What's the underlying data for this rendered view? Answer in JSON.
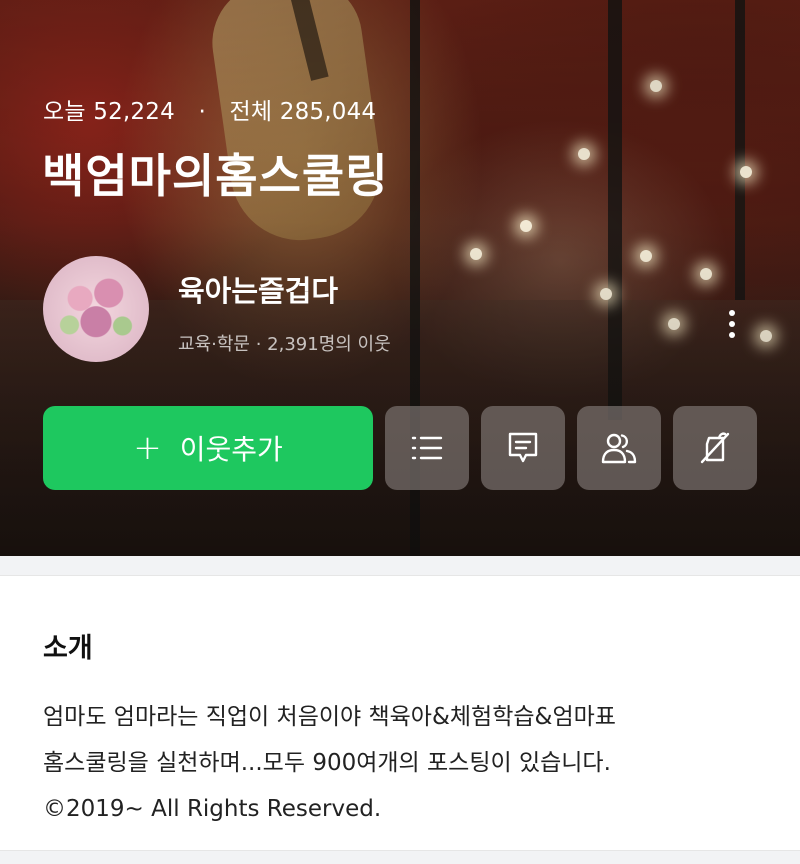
{
  "header": {
    "today_label": "오늘",
    "today_count": "52,224",
    "separator": "·",
    "total_label": "전체",
    "total_count": "285,044",
    "blog_title": "백엄마의홈스쿨링"
  },
  "profile": {
    "nickname": "육아는즐겁다",
    "category": "교육·학문",
    "meta_separator": "·",
    "neighbors": "2,391명의 이웃"
  },
  "actions": {
    "add_neighbor_label": "이웃추가",
    "add_icon": "plus-icon",
    "buttons": [
      {
        "icon": "list-icon"
      },
      {
        "icon": "chat-bubble-icon"
      },
      {
        "icon": "people-icon"
      },
      {
        "icon": "no-audio-icon"
      }
    ]
  },
  "intro": {
    "title": "소개",
    "lines": [
      "엄마도 엄마라는 직업이 처음이야 책육아&체험학습&엄마표",
      "홈스쿨링을 실천하며...모두 900여개의 포스팅이 있습니다.",
      "©2019~ All Rights Reserved."
    ]
  },
  "colors": {
    "primary_green": "#1ec85f",
    "icon_button_bg": "#87807c"
  }
}
